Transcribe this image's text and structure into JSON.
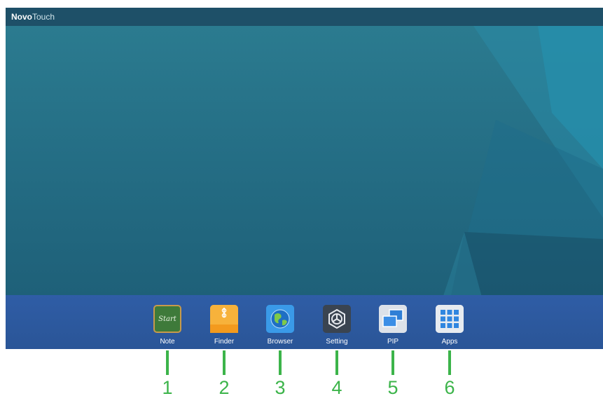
{
  "titlebar": {
    "brand_bold": "Novo",
    "brand_light": "Touch"
  },
  "dock": {
    "items": [
      {
        "label": "Note",
        "icon": "note-chalkboard-icon",
        "icon_text": "Start"
      },
      {
        "label": "Finder",
        "icon": "finder-folder-icon"
      },
      {
        "label": "Browser",
        "icon": "browser-globe-icon"
      },
      {
        "label": "Setting",
        "icon": "setting-gear-icon"
      },
      {
        "label": "PIP",
        "icon": "pip-windows-icon"
      },
      {
        "label": "Apps",
        "icon": "apps-grid-icon"
      }
    ]
  },
  "callouts": [
    "1",
    "2",
    "3",
    "4",
    "5",
    "6"
  ],
  "colors": {
    "desktop": "#2c7d91",
    "titlebar": "#1e5068",
    "dock": "#2f5da6",
    "callout": "#3cb44a"
  }
}
